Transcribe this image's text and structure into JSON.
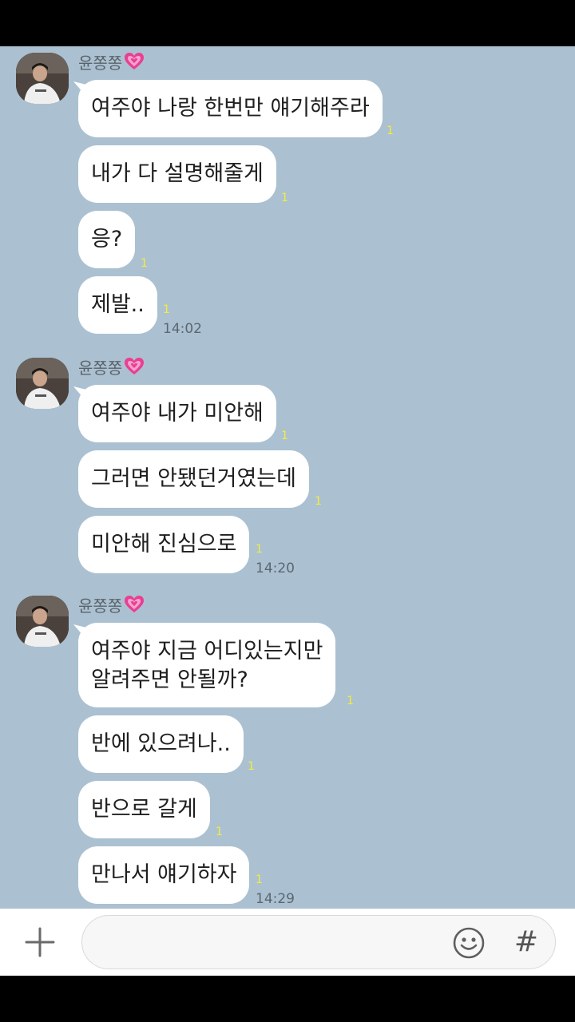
{
  "groups": [
    {
      "sender": "윤쫑쫑",
      "messages": [
        {
          "lines": [
            "여주야 나랑 한번만 얘기해주라"
          ],
          "unread": "1"
        },
        {
          "lines": [
            "내가 다 설명해줄게"
          ],
          "unread": "1"
        },
        {
          "lines": [
            "응?"
          ],
          "unread": "1"
        },
        {
          "lines": [
            "제발.."
          ],
          "unread": "1",
          "time": "14:02"
        }
      ]
    },
    {
      "sender": "윤쫑쫑",
      "messages": [
        {
          "lines": [
            "여주야 내가 미안해"
          ],
          "unread": "1"
        },
        {
          "lines": [
            "그러면 안됐던거였는데"
          ],
          "unread": "1"
        },
        {
          "lines": [
            "미안해 진심으로"
          ],
          "unread": "1",
          "time": "14:20"
        }
      ]
    },
    {
      "sender": "윤쫑쫑",
      "messages": [
        {
          "lines": [
            "여주야 지금 어디있는지만",
            "알려주면 안될까?"
          ],
          "unread": "1"
        },
        {
          "lines": [
            "반에 있으려나.."
          ],
          "unread": "1"
        },
        {
          "lines": [
            "반으로 갈게"
          ],
          "unread": "1"
        },
        {
          "lines": [
            "만나서 얘기하자"
          ],
          "unread": "1",
          "time": "14:29"
        }
      ]
    }
  ],
  "sender_icon": "heart-icon",
  "input": {
    "placeholder": "",
    "value": ""
  },
  "icons": {
    "attach": "plus-icon",
    "emoji": "smiley-icon",
    "hashtag": "hash-icon"
  },
  "hash_symbol": "#",
  "colors": {
    "chat_bg": "#abc1d1",
    "bubble": "#ffffff",
    "unread": "#f5ec3a",
    "heart": "#e83f94"
  }
}
